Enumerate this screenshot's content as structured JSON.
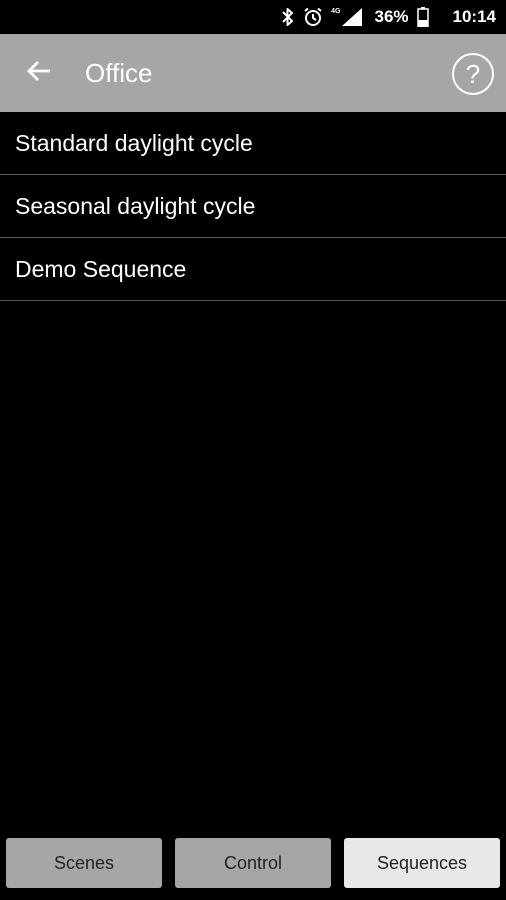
{
  "status_bar": {
    "network_tag": "4G",
    "battery_percent": "36%",
    "time": "10:14",
    "icons": [
      "bluetooth-icon",
      "alarm-icon",
      "signal-icon",
      "battery-icon"
    ]
  },
  "header": {
    "title": "Office",
    "back_icon": "arrow-left-icon",
    "help_label": "?"
  },
  "sequences": [
    {
      "label": "Standard daylight cycle"
    },
    {
      "label": "Seasonal daylight cycle"
    },
    {
      "label": "Demo Sequence"
    }
  ],
  "tabs": [
    {
      "label": "Scenes",
      "active": false
    },
    {
      "label": "Control",
      "active": false
    },
    {
      "label": "Sequences",
      "active": true
    }
  ],
  "colors": {
    "background": "#000000",
    "app_bar": "#a6a6a6",
    "tab_inactive": "#a6a6a6",
    "tab_active": "#e8e8e8",
    "divider": "#5a5a5a"
  }
}
